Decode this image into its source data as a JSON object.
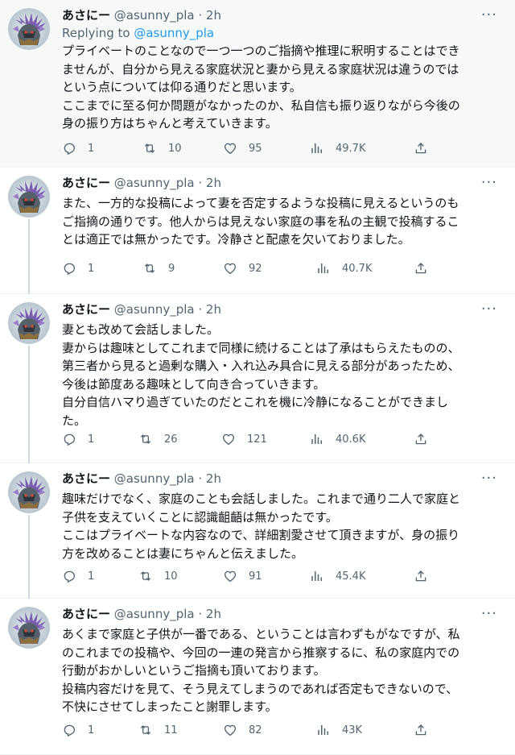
{
  "tweets": [
    {
      "name": "あさにー",
      "handle": "@asunny_pla",
      "time": "· 2h",
      "reply_prefix": "Replying to ",
      "reply_to": "@asunny_pla",
      "lines": [
        "プライベートのことなので一つ一つのご指摘や推理に釈明することはでき",
        "ませんが、自分から見える家庭状況と妻から見える家庭状況は違うのでは",
        "という点については仰る通りだと思います。",
        "ここまでに至る何か問題がなかったのか、私自信も振り返りながら今後の",
        "身の振り方はちゃんと考えていきます。"
      ],
      "replies": "1",
      "retweets": "10",
      "likes": "95",
      "views": "49.7K"
    },
    {
      "name": "あさにー",
      "handle": "@asunny_pla",
      "time": "· 2h",
      "lines": [
        "また、一方的な投稿によって妻を否定するような投稿に見えるというのも",
        "ご指摘の通りです。他人からは見えない家庭の事を私の主観で投稿するこ",
        "とは適正では無かったです。冷静さと配慮を欠いておりました。"
      ],
      "replies": "1",
      "retweets": "9",
      "likes": "92",
      "views": "40.7K"
    },
    {
      "name": "あさにー",
      "handle": "@asunny_pla",
      "time": "· 2h",
      "lines": [
        "妻とも改めて会話しました。",
        "妻からは趣味としてこれまで同様に続けることは了承はもらえたものの、",
        "第三者から見ると過剰な購入・入れ込み具合に見える部分があったため、",
        "今後は節度ある趣味として向き合っていきます。",
        "自分自信ハマり過ぎていたのだとこれを機に冷静になることができまし",
        "た。"
      ],
      "replies": "1",
      "retweets": "26",
      "likes": "121",
      "views": "40.6K"
    },
    {
      "name": "あさにー",
      "handle": "@asunny_pla",
      "time": "· 2h",
      "lines": [
        "趣味だけでなく、家庭のことも会話しました。これまで通り二人で家庭と",
        "子供を支えていくことに認識齟齬は無かったです。",
        "ここはプライベートな内容なので、詳細割愛させて頂きますが、身の振り",
        "方を改めることは妻にちゃんと伝えました。"
      ],
      "replies": "1",
      "retweets": "10",
      "likes": "91",
      "views": "45.4K"
    },
    {
      "name": "あさにー",
      "handle": "@asunny_pla",
      "time": "· 2h",
      "lines": [
        "あくまで家庭と子供が一番である、ということは言わずもがなですが、私",
        "のこれまでの投稿や、今回の一連の発言から推察するに、私の家庭内での",
        "行動がおかしいというご指摘も頂いております。",
        "投稿内容だけを見て、そう見えてしまうのであれば否定もできないので、",
        "不快にさせてしまったこと謝罪します。"
      ],
      "replies": "1",
      "retweets": "11",
      "likes": "82",
      "views": "43K"
    }
  ],
  "more_glyph": "···",
  "colors": {
    "accent": "#1d9bf0",
    "muted": "#536471",
    "text": "#0f1419",
    "highlight_bg": "#f7f9f9",
    "thread_line": "#cfd9de"
  },
  "icons": {
    "reply": "reply-icon",
    "retweet": "retweet-icon",
    "like": "heart-icon",
    "views": "views-icon",
    "share": "share-icon",
    "more": "more-icon"
  }
}
